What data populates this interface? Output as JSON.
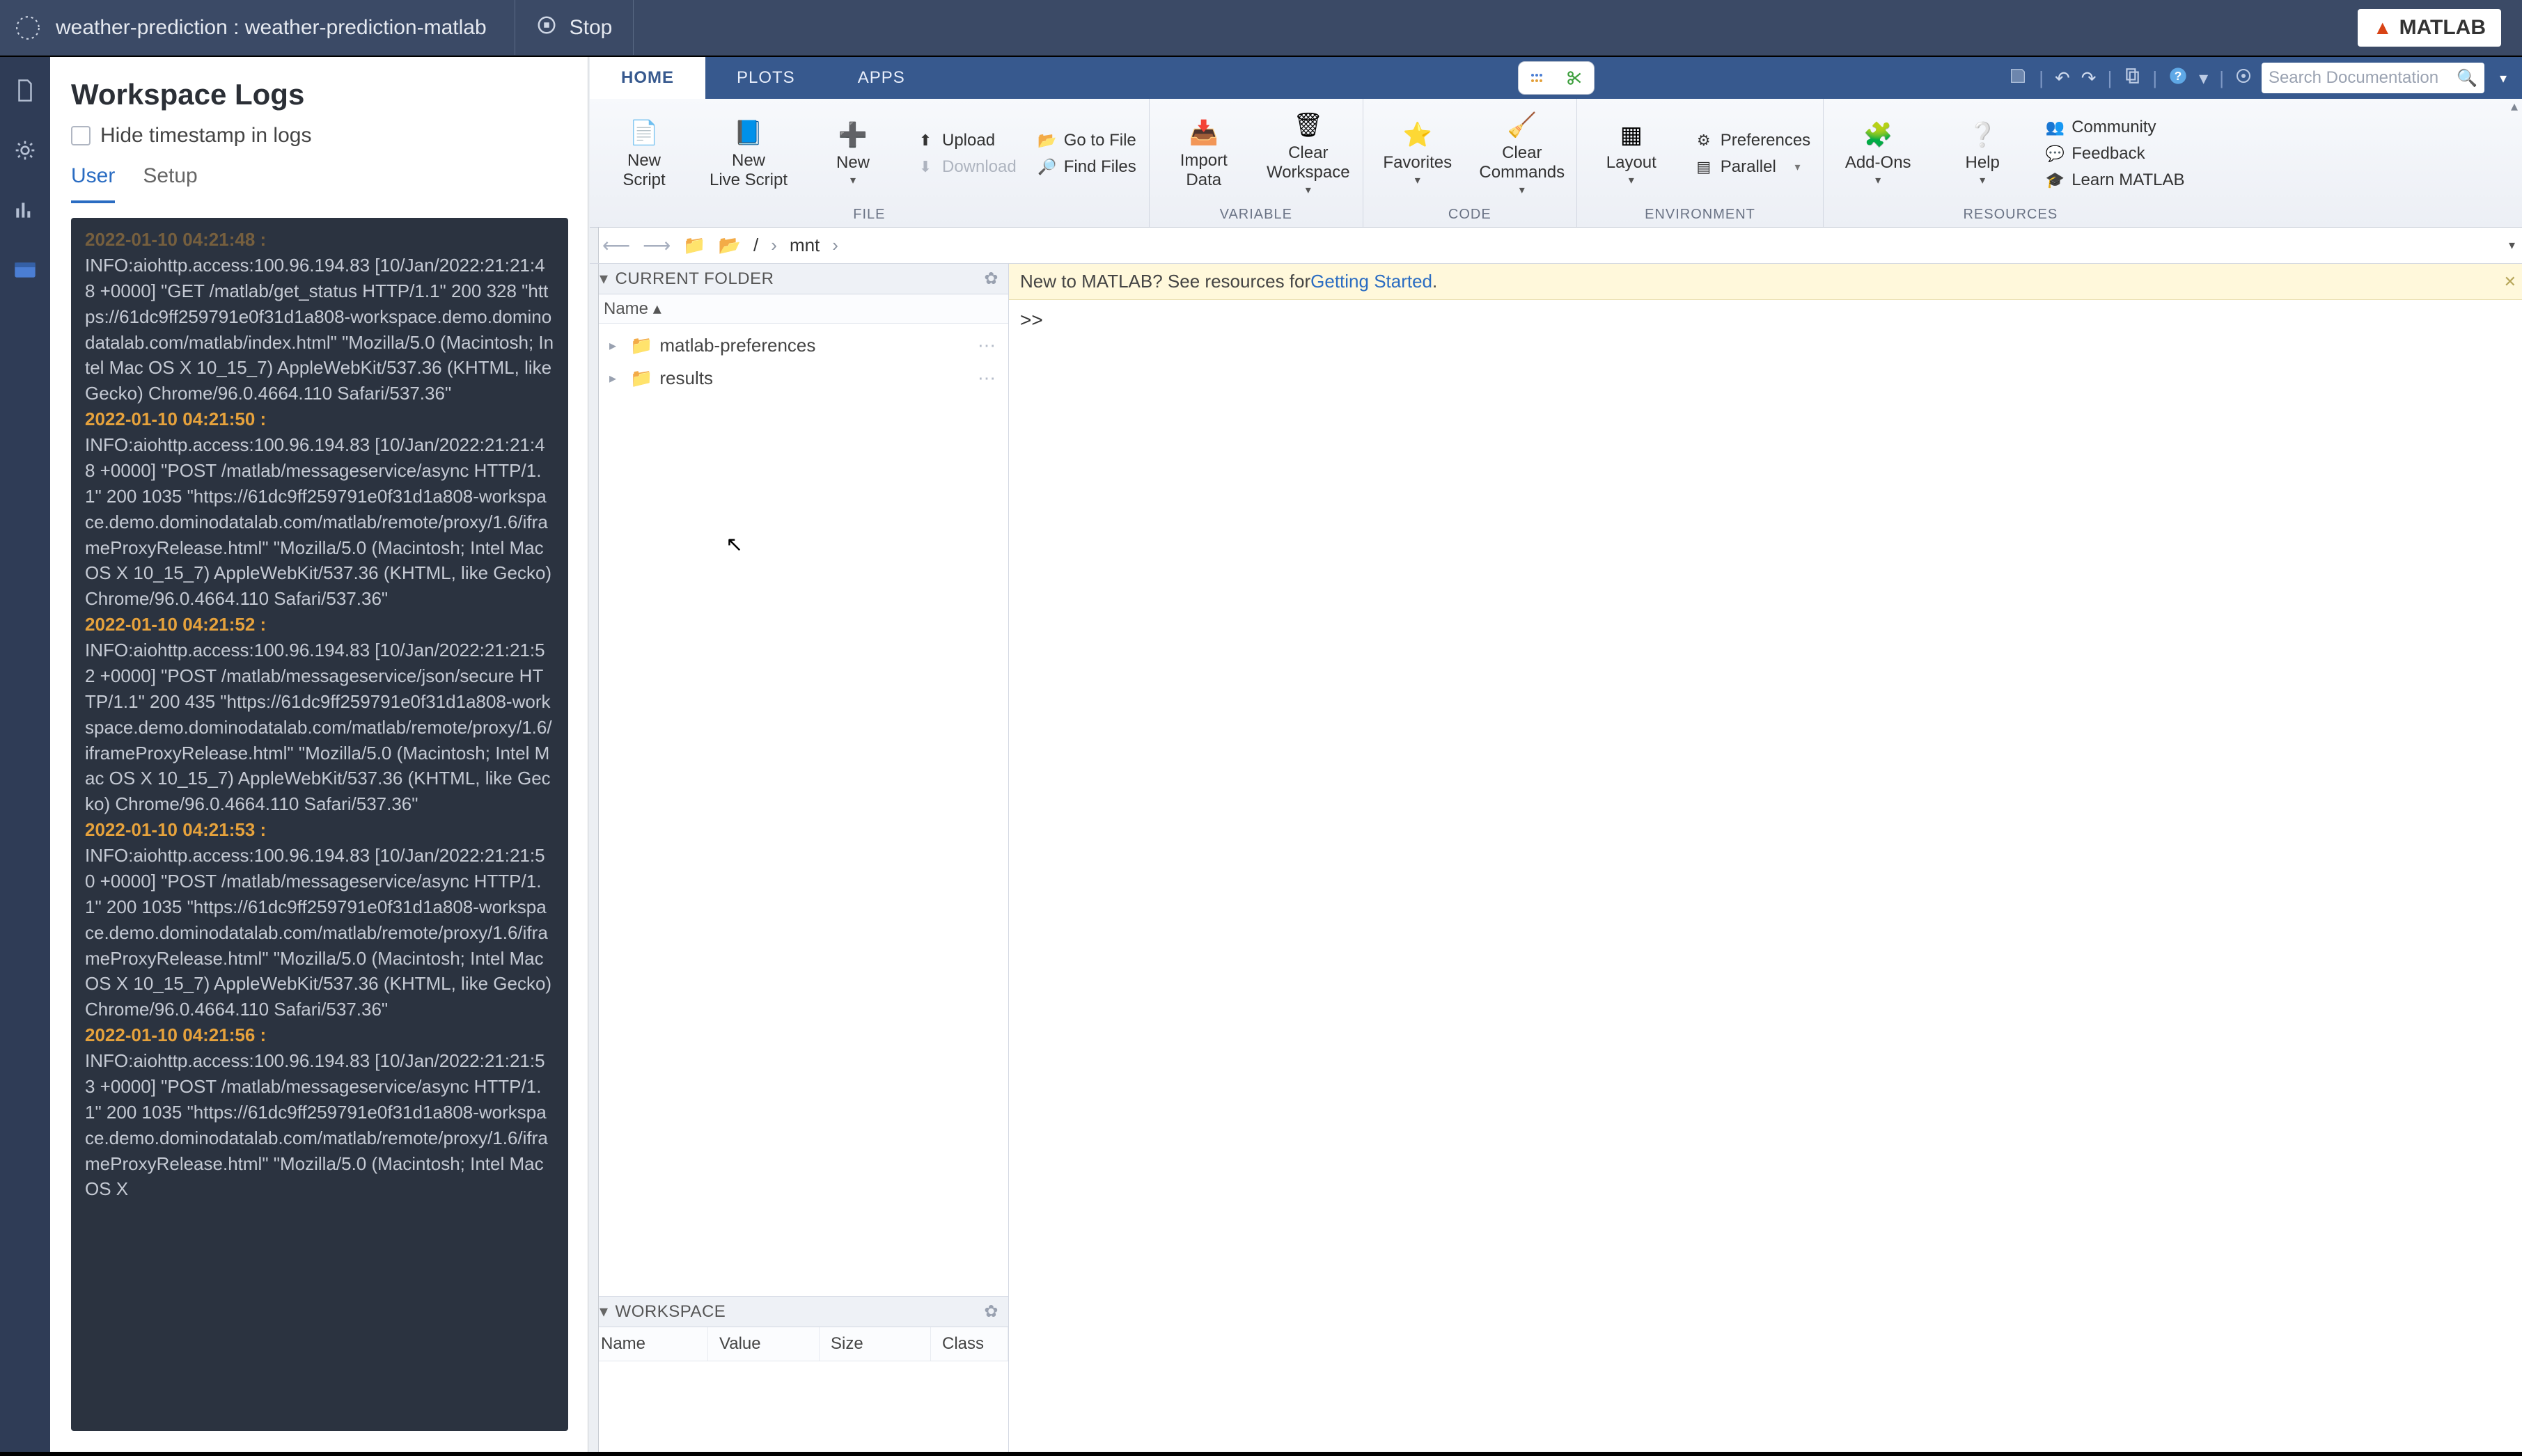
{
  "topbar": {
    "title": "weather-prediction : weather-prediction-matlab",
    "stop_label": "Stop",
    "matlab_badge": "MATLAB"
  },
  "logs": {
    "title": "Workspace Logs",
    "hide_timestamp_label": "Hide timestamp in logs",
    "tabs": {
      "user": "User",
      "setup": "Setup"
    },
    "entries": [
      {
        "ts": "2022-01-10 04:21:48 :",
        "body": "INFO:aiohttp.access:100.96.194.83 [10/Jan/2022:21:21:48 +0000] \"GET /matlab/get_status HTTP/1.1\" 200 328 \"https://61dc9ff259791e0f31d1a808-workspace.demo.dominodatalab.com/matlab/index.html\" \"Mozilla/5.0 (Macintosh; Intel Mac OS X 10_15_7) AppleWebKit/537.36 (KHTML, like Gecko) Chrome/96.0.4664.110 Safari/537.36\""
      },
      {
        "ts": "2022-01-10 04:21:50 :",
        "body": "INFO:aiohttp.access:100.96.194.83 [10/Jan/2022:21:21:48 +0000] \"POST /matlab/messageservice/async HTTP/1.1\" 200 1035 \"https://61dc9ff259791e0f31d1a808-workspace.demo.dominodatalab.com/matlab/remote/proxy/1.6/iframeProxyRelease.html\" \"Mozilla/5.0 (Macintosh; Intel Mac OS X 10_15_7) AppleWebKit/537.36 (KHTML, like Gecko) Chrome/96.0.4664.110 Safari/537.36\""
      },
      {
        "ts": "2022-01-10 04:21:52 :",
        "body": "INFO:aiohttp.access:100.96.194.83 [10/Jan/2022:21:21:52 +0000] \"POST /matlab/messageservice/json/secure HTTP/1.1\" 200 435 \"https://61dc9ff259791e0f31d1a808-workspace.demo.dominodatalab.com/matlab/remote/proxy/1.6/iframeProxyRelease.html\" \"Mozilla/5.0 (Macintosh; Intel Mac OS X 10_15_7) AppleWebKit/537.36 (KHTML, like Gecko) Chrome/96.0.4664.110 Safari/537.36\""
      },
      {
        "ts": "2022-01-10 04:21:53 :",
        "body": "INFO:aiohttp.access:100.96.194.83 [10/Jan/2022:21:21:50 +0000] \"POST /matlab/messageservice/async HTTP/1.1\" 200 1035 \"https://61dc9ff259791e0f31d1a808-workspace.demo.dominodatalab.com/matlab/remote/proxy/1.6/iframeProxyRelease.html\" \"Mozilla/5.0 (Macintosh; Intel Mac OS X 10_15_7) AppleWebKit/537.36 (KHTML, like Gecko) Chrome/96.0.4664.110 Safari/537.36\""
      },
      {
        "ts": "2022-01-10 04:21:56 :",
        "body": "INFO:aiohttp.access:100.96.194.83 [10/Jan/2022:21:21:53 +0000] \"POST /matlab/messageservice/async HTTP/1.1\" 200 1035 \"https://61dc9ff259791e0f31d1a808-workspace.demo.dominodatalab.com/matlab/remote/proxy/1.6/iframeProxyRelease.html\" \"Mozilla/5.0 (Macintosh; Intel Mac OS X"
      }
    ]
  },
  "ide_tabs": {
    "home": "HOME",
    "plots": "PLOTS",
    "apps": "APPS"
  },
  "search_placeholder": "Search Documentation",
  "toolstrip": {
    "file": {
      "label": "FILE",
      "new_script": "New\nScript",
      "new_live_script": "New\nLive Script",
      "new": "New",
      "upload": "Upload",
      "download": "Download",
      "goto_file": "Go to File",
      "find_files": "Find Files"
    },
    "variable": {
      "label": "VARIABLE",
      "import_data": "Import\nData",
      "clear_ws": "Clear\nWorkspace"
    },
    "code": {
      "label": "CODE",
      "favorites": "Favorites",
      "clear_cmds": "Clear\nCommands"
    },
    "environment": {
      "label": "ENVIRONMENT",
      "layout": "Layout",
      "preferences": "Preferences",
      "parallel": "Parallel"
    },
    "resources": {
      "label": "RESOURCES",
      "addons": "Add-Ons",
      "help": "Help",
      "community": "Community",
      "feedback": "Feedback",
      "learn": "Learn MATLAB"
    }
  },
  "breadcrumb": {
    "root": "/",
    "seg1": "mnt"
  },
  "current_folder": {
    "title": "CURRENT FOLDER",
    "col_name": "Name",
    "items": [
      {
        "label": "matlab-preferences"
      },
      {
        "label": "results"
      }
    ]
  },
  "workspace": {
    "title": "WORKSPACE",
    "cols": {
      "name": "Name",
      "value": "Value",
      "size": "Size",
      "class": "Class"
    }
  },
  "banner": {
    "prefix": "New to MATLAB? See resources for ",
    "link": "Getting Started",
    "suffix": "."
  },
  "cmd_prompt": ">>"
}
